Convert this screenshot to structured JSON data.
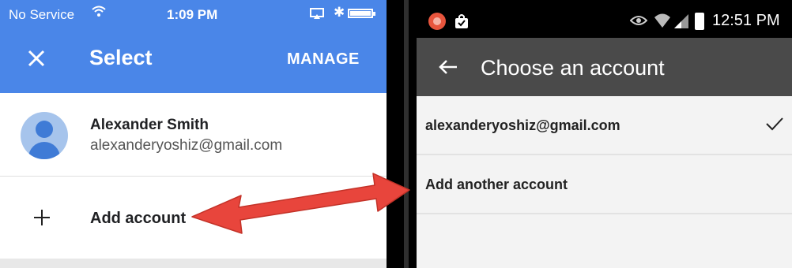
{
  "ios": {
    "status": {
      "carrier": "No Service",
      "time": "1:09 PM"
    },
    "toolbar": {
      "title": "Select",
      "manage_label": "MANAGE"
    },
    "account": {
      "name": "Alexander Smith",
      "email": "alexanderyoshiz@gmail.com"
    },
    "add_account_label": "Add account",
    "colors": {
      "accent": "#4a86e8",
      "avatar_bg": "#a6c4ec",
      "avatar_fg": "#3f7bd6"
    }
  },
  "android": {
    "status": {
      "time": "12:51 PM"
    },
    "toolbar": {
      "title": "Choose an account"
    },
    "rows": [
      {
        "label": "alexanderyoshiz@gmail.com",
        "selected": true
      },
      {
        "label": "Add another account",
        "selected": false
      }
    ],
    "colors": {
      "toolbar_bg": "#4a4a4a",
      "row_bg": "#f3f3f3"
    }
  },
  "annotation": {
    "arrow_color": "#e8453c"
  }
}
